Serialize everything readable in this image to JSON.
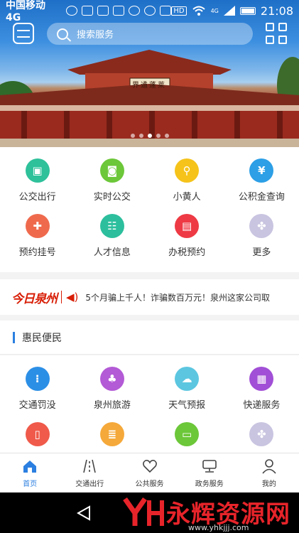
{
  "status_bar": {
    "carrier": "中国移动 4G",
    "network": "4G",
    "hd": "HD",
    "time": "21:08"
  },
  "header": {
    "search_placeholder": "搜索服务"
  },
  "banner": {
    "plaque_text": "界遹蓬莱",
    "slides": 6,
    "active_slide": 3
  },
  "quick_services": [
    {
      "label": "公交出行",
      "icon": "bus-icon",
      "color": "#2ec19a"
    },
    {
      "label": "实时公交",
      "icon": "realtime-bus-icon",
      "color": "#6cc739"
    },
    {
      "label": "小黄人",
      "icon": "bicycle-icon",
      "color": "#f5c31a"
    },
    {
      "label": "公积金查询",
      "icon": "fund-icon",
      "color": "#2c9fe6"
    },
    {
      "label": "预约挂号",
      "icon": "doctor-icon",
      "color": "#ef6a4d"
    },
    {
      "label": "人才信息",
      "icon": "people-icon",
      "color": "#2dbf9d"
    },
    {
      "label": "办税预约",
      "icon": "tax-icon",
      "color": "#ee3a44"
    },
    {
      "label": "更多",
      "icon": "more-icon",
      "color": "#c9c4e0"
    }
  ],
  "news": {
    "brand": "今日泉州",
    "headline": "5个月骗上千人！诈骗数百万元！泉州这家公司取"
  },
  "section": {
    "title": "惠民便民"
  },
  "convenience_services": [
    {
      "label": "交通罚没",
      "icon": "traffic-light-icon",
      "color": "#2c8fe6"
    },
    {
      "label": "泉州旅游",
      "icon": "palm-tree-icon",
      "color": "#b35ad6"
    },
    {
      "label": "天气预报",
      "icon": "cloud-icon",
      "color": "#5cc6e0"
    },
    {
      "label": "快递服务",
      "icon": "package-icon",
      "color": "#a14fd6"
    },
    {
      "label": "",
      "icon": "phone-icon",
      "color": "#ef5a4a"
    },
    {
      "label": "",
      "icon": "document-icon",
      "color": "#f5a93a"
    },
    {
      "label": "",
      "icon": "tv-icon",
      "color": "#6cc739"
    },
    {
      "label": "",
      "icon": "more-icon",
      "color": "#c9c4e0"
    }
  ],
  "tabs": [
    {
      "label": "首页",
      "icon": "home-icon",
      "active": true
    },
    {
      "label": "交通出行",
      "icon": "road-icon",
      "active": false
    },
    {
      "label": "公共服务",
      "icon": "heart-icon",
      "active": false
    },
    {
      "label": "政务服务",
      "icon": "government-icon",
      "active": false
    },
    {
      "label": "我的",
      "icon": "user-icon",
      "active": false
    }
  ],
  "watermark": {
    "text": "永辉资源网",
    "url": "www.yhkjjj.com"
  }
}
